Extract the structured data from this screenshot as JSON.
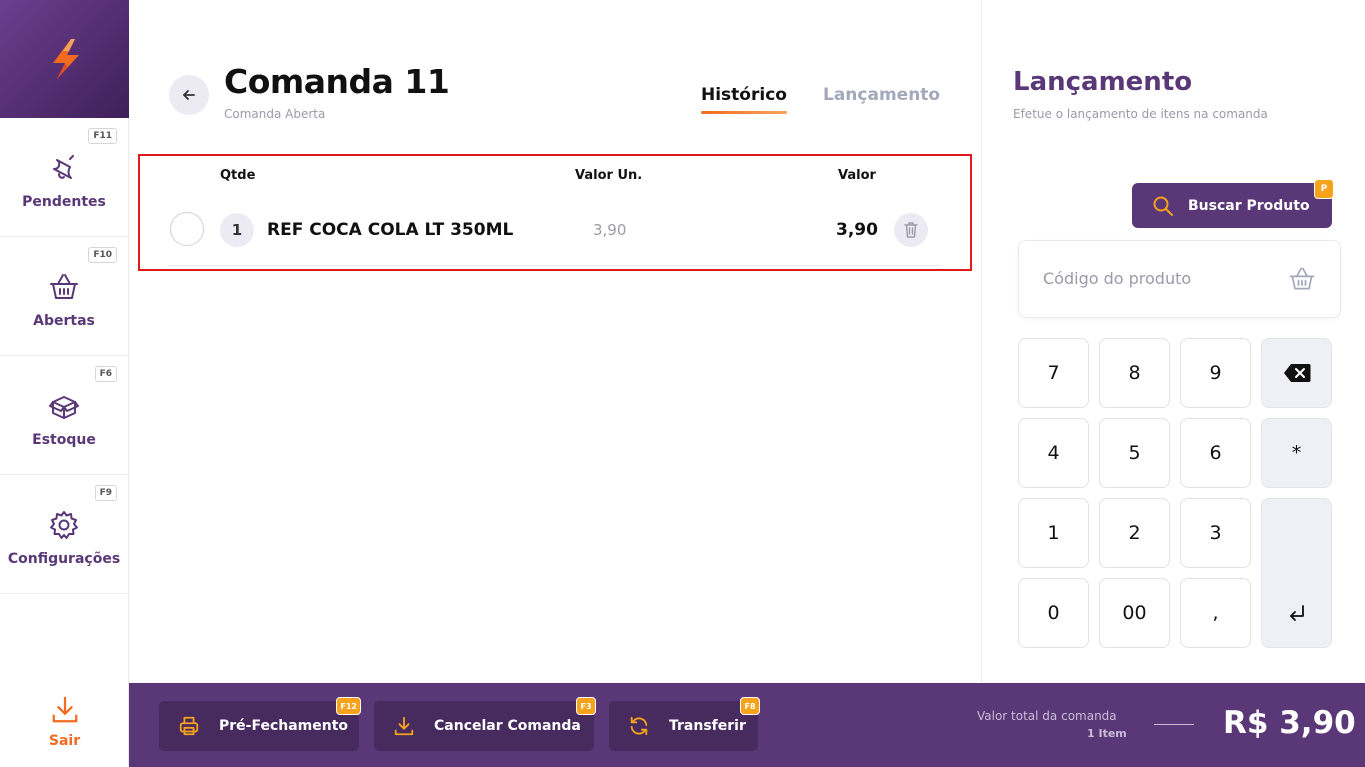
{
  "sidebar": {
    "items": [
      {
        "label": "Pendentes",
        "key": "F11",
        "icon": "bell-icon"
      },
      {
        "label": "Abertas",
        "key": "F10",
        "icon": "basket-icon"
      },
      {
        "label": "Estoque",
        "key": "F6",
        "icon": "box-icon"
      },
      {
        "label": "Configurações",
        "key": "F9",
        "icon": "gear-icon"
      }
    ],
    "exit_label": "Sair"
  },
  "header": {
    "title": "Comanda 11",
    "subtitle": "Comanda Aberta",
    "tabs": [
      {
        "label": "Histórico",
        "active": true
      },
      {
        "label": "Lançamento",
        "active": false
      }
    ]
  },
  "table": {
    "columns": {
      "qty": "Qtde",
      "unit": "Valor Un.",
      "total": "Valor"
    },
    "rows": [
      {
        "qty": "1",
        "name": "REF COCA COLA LT 350ML",
        "unit": "3,90",
        "total": "3,90"
      }
    ]
  },
  "panel": {
    "title": "Lançamento",
    "subtitle": "Efetue o lançamento de itens na comanda",
    "search_label": "Buscar Produto",
    "search_key": "P",
    "code_placeholder": "Código do produto",
    "keys": {
      "k7": "7",
      "k8": "8",
      "k9": "9",
      "k4": "4",
      "k5": "5",
      "k6": "6",
      "star": "*",
      "k1": "1",
      "k2": "2",
      "k3": "3",
      "k0": "0",
      "k00": "00",
      "comma": ","
    }
  },
  "footer": {
    "buttons": [
      {
        "label": "Pré-Fechamento",
        "key": "F12"
      },
      {
        "label": "Cancelar Comanda",
        "key": "F3"
      },
      {
        "label": "Transferir",
        "key": "F8"
      }
    ],
    "total_label": "Valor total da comanda",
    "items_count": "1 Item",
    "total_value": "R$ 3,90"
  },
  "colors": {
    "brand_purple": "#5a3777",
    "accent_orange": "#f26b21",
    "badge_yellow": "#f7a21b",
    "highlight_red": "#e01919"
  }
}
